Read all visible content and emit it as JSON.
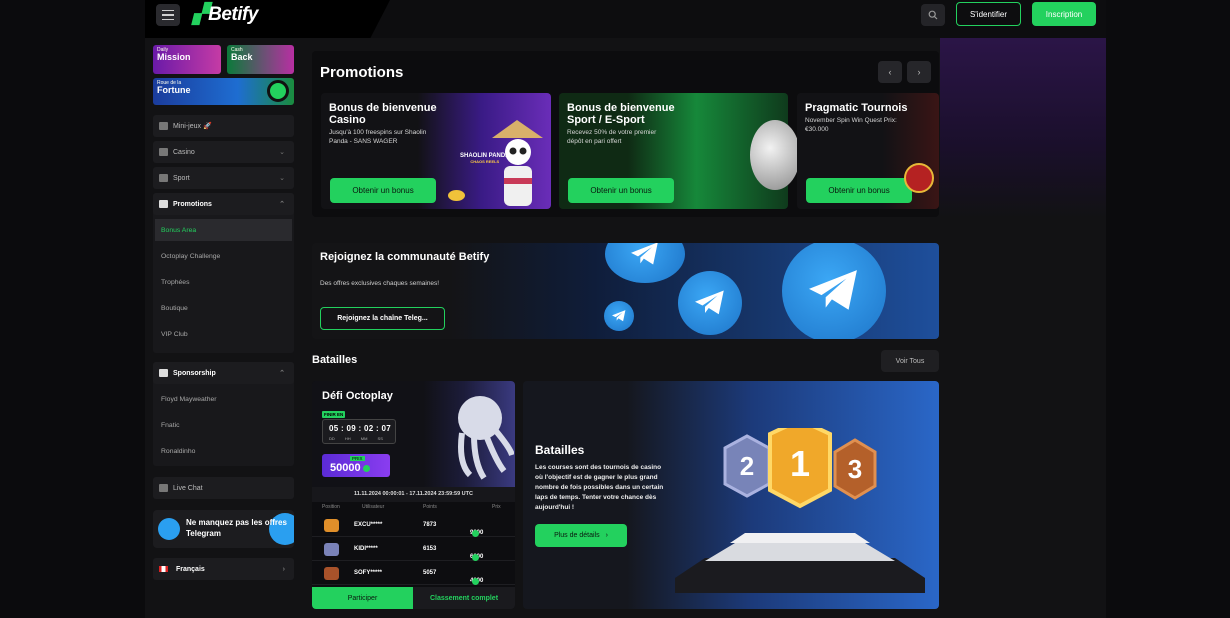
{
  "header": {
    "logo_text": "Betify",
    "login_label": "S'identifier",
    "signup_label": "Inscription",
    "accent_color": "#23d15e"
  },
  "sidebar": {
    "tiles": {
      "mission_small": "Daily",
      "mission": "Mission",
      "cash_small": "Cash",
      "cash": "Back",
      "roue_small": "Roue de la",
      "roue": "Fortune"
    },
    "items": [
      {
        "label": "Mini-jeux 🚀",
        "icon": "rocket-icon"
      },
      {
        "label": "Casino",
        "icon": "slot-icon"
      },
      {
        "label": "Sport",
        "icon": "sport-icon"
      },
      {
        "label": "Promotions",
        "icon": "megaphone-icon"
      }
    ],
    "promotions_sub": [
      "Bonus Area",
      "Octoplay Challenge",
      "Trophées",
      "Boutique",
      "VIP Club"
    ],
    "sponsorship_label": "Sponsorship",
    "sponsorship_sub": [
      "Floyd Mayweather",
      "Fnatic",
      "Ronaldinho"
    ],
    "live_chat": "Live Chat",
    "telegram_card": "Ne manquez pas les offres Telegram",
    "language": "Français"
  },
  "promotions": {
    "title": "Promotions",
    "cards": [
      {
        "title": "Bonus de bienvenue Casino",
        "desc": "Jusqu'à 100 freespins sur Shaolin Panda - SANS WAGER",
        "cta": "Obtenir un bonus"
      },
      {
        "title": "Bonus de bienvenue Sport / E-Sport",
        "desc": "Recevez 50% de votre premier dépôt en pari offert",
        "cta": "Obtenir un bonus"
      },
      {
        "title": "Pragmatic Tournois",
        "desc": "November Spin Win Quest Prix: €30.000",
        "cta": "Obtenir un bonus"
      }
    ],
    "panda_label": "SHAOLIN PANDA",
    "panda_sub": "CHAOS REELS"
  },
  "telegram_banner": {
    "title": "Rejoignez la communauté Betify",
    "desc": "Des offres exclusives chaques semaines!",
    "cta": "Rejoignez la chaîne Teleg..."
  },
  "batailles": {
    "title": "Batailles",
    "see_all": "Voir Tous",
    "defi": {
      "title": "Défi Octoplay",
      "ends_label": "FINIR EN",
      "timer": "05 : 09 : 02 : 07",
      "timer_labels": "DD HH MM SS",
      "prize_label": "PRIX",
      "prize_value": "50000",
      "dates": "11.11.2024 00:00:01 - 17.11.2024 23:59:59 UTC",
      "columns": [
        "Position",
        "Utilisateur",
        "Points",
        "Prix"
      ],
      "rows": [
        {
          "user": "EXCU*****",
          "points": "7873",
          "prize": "9000"
        },
        {
          "user": "KIDI*****",
          "points": "6153",
          "prize": "6000"
        },
        {
          "user": "SOFY*****",
          "points": "5057",
          "prize": "4000"
        }
      ],
      "participate": "Participer",
      "ranking": "Classement complet"
    },
    "banner": {
      "title": "Batailles",
      "desc": "Les courses sont des tournois de casino où l'objectif est de gagner le plus grand nombre de fois possibles dans un certain laps de temps. Tenter votre chance dès aujourd'hui !",
      "cta": "Plus de détails",
      "ranks": [
        "2",
        "1",
        "3"
      ]
    }
  }
}
